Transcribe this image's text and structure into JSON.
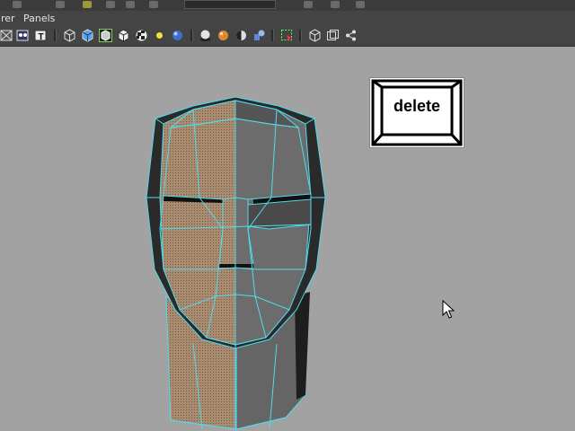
{
  "menubar": {
    "items": [
      "rer",
      "Panels"
    ]
  },
  "toolbar": {
    "icons": [
      "wireframe-icon",
      "smooth-shade-icon",
      "texture-icon",
      "shaded-cube-icon",
      "solid-cube-icon",
      "wireframe-on-shaded-icon",
      "wire-cube-icon",
      "checker-texture-icon",
      "light-bulb-icon",
      "lit-sphere-icon",
      "shadow-sphere-icon",
      "render-sphere-icon",
      "half-sphere-icon",
      "multi-object-icon",
      "select-region-icon",
      "bounding-box-icon",
      "grid-frame-icon",
      "share-nodes-icon"
    ]
  },
  "overlay": {
    "key_label": "delete"
  },
  "colors": {
    "viewport_bg": "#a2a2a2",
    "wire": "#4fdcf0",
    "face_left": "#a98b6f",
    "face_right": "#6c6c6c"
  }
}
